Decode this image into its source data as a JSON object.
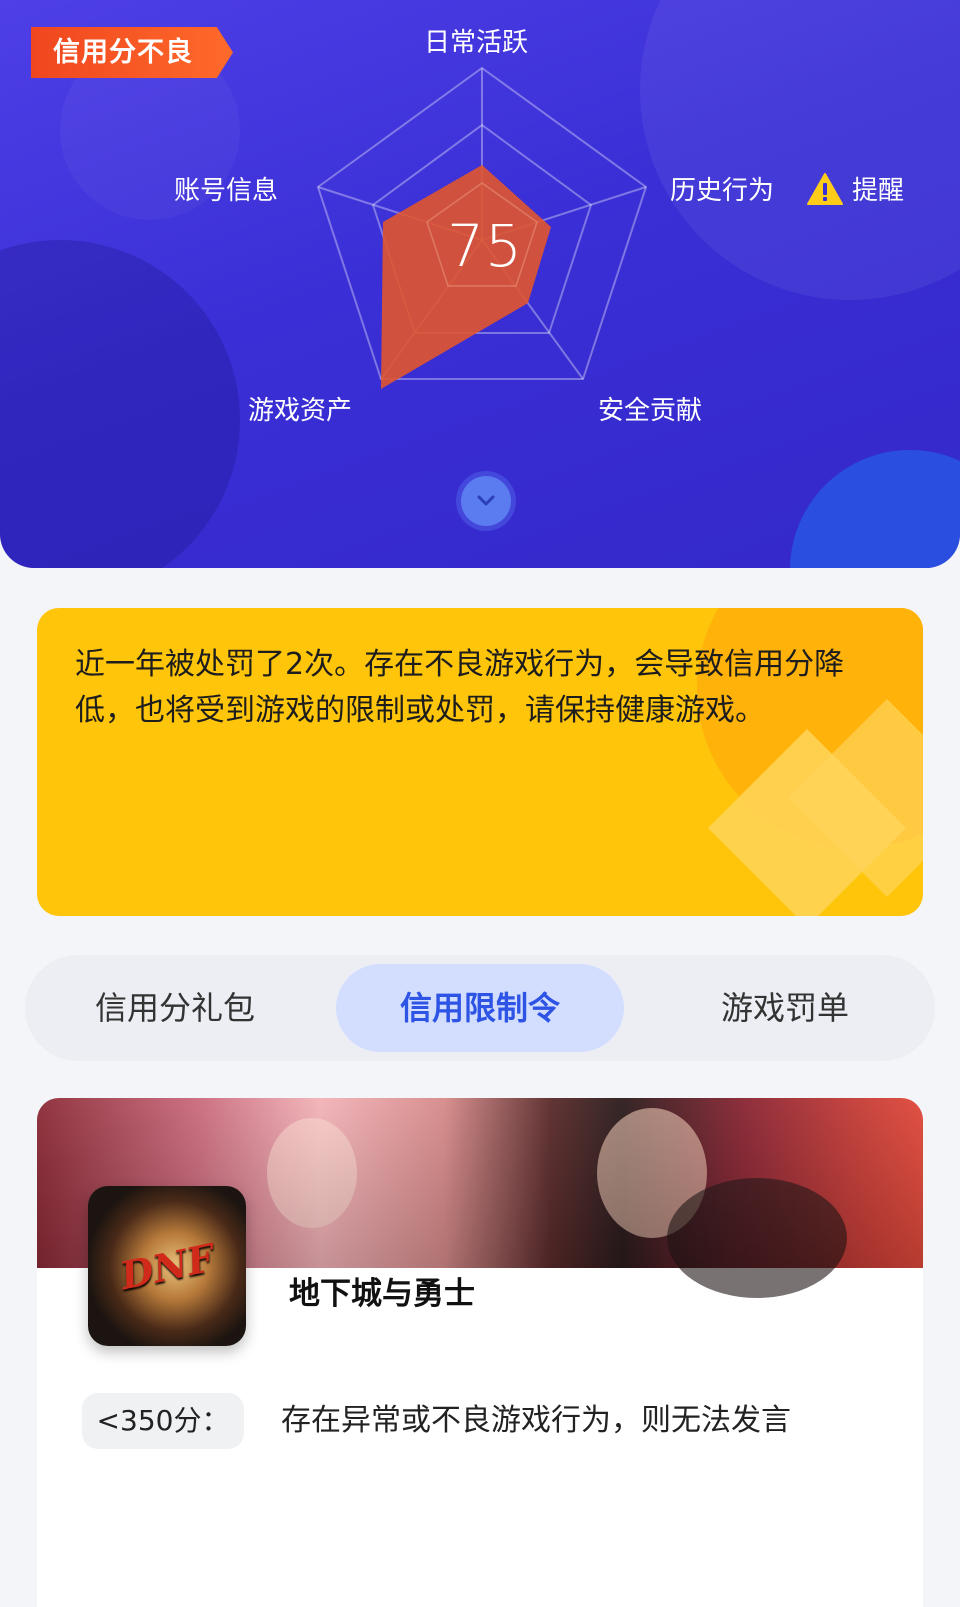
{
  "badge": "信用分不良",
  "radar": {
    "score": "75",
    "labels": {
      "top": "日常活跃",
      "right": "历史行为",
      "bottom_right": "安全贡献",
      "bottom_left": "游戏资产",
      "left": "账号信息"
    },
    "warning_label": "提醒"
  },
  "notice": {
    "text": "近一年被处罚了2次。存在不良游戏行为，会导致信用分降低，也将受到游戏的限制或处罚，请保持健康游戏。"
  },
  "tabs": [
    {
      "label": "信用分礼包",
      "active": false
    },
    {
      "label": "信用限制令",
      "active": true
    },
    {
      "label": "游戏罚单",
      "active": false
    }
  ],
  "card": {
    "game_name": "地下城与勇士",
    "logo_text": "DNF",
    "rule_tag": "<350分：",
    "rule_text": "存在异常或不良游戏行为，则无法发言"
  },
  "colors": {
    "hero_bg": "#3a2fd6",
    "badge": "#f0461f",
    "radar_fill": "#e0552e",
    "notice_bg": "#ffc50a",
    "tab_active_bg": "#d3defe",
    "tab_active_text": "#2e54e6"
  },
  "icons": [
    "warning-icon",
    "chevron-down-icon"
  ]
}
